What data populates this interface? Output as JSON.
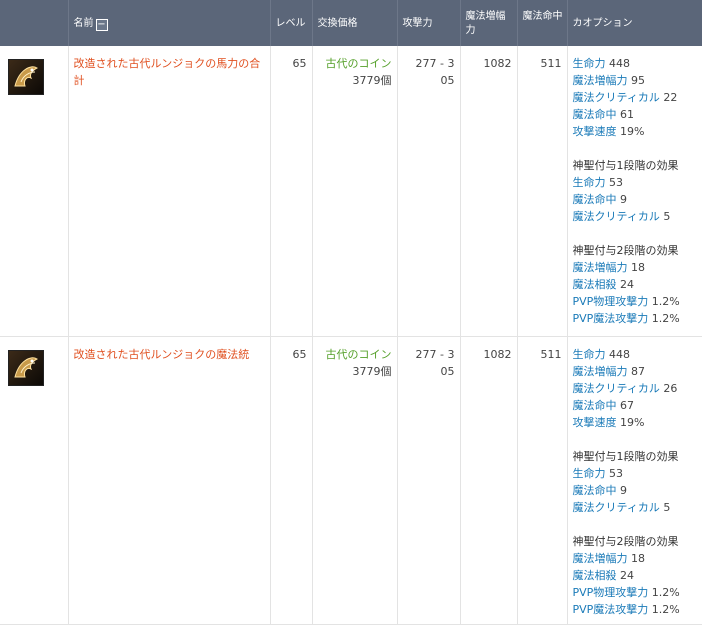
{
  "header": {
    "name": "名前",
    "toggle": "−",
    "level": "レベル",
    "price": "交換価格",
    "attack": "攻撃力",
    "magic_amp": "魔法増幅力",
    "magic_hit": "魔法命中",
    "option": "カオプション"
  },
  "rows": [
    {
      "name": "改造された古代ルンジョクの馬力の合計",
      "level": "65",
      "currency": "古代のコイン",
      "count": "3779個",
      "attack": "277 - 305",
      "magic_amp": "1082",
      "magic_hit": "511",
      "options": [
        {
          "k": "生命力",
          "v": "448"
        },
        {
          "k": "魔法増幅力",
          "v": "95"
        },
        {
          "k": "魔法クリティカル",
          "v": "22"
        },
        {
          "k": "魔法命中",
          "v": "61"
        },
        {
          "k": "攻撃速度",
          "v": "19%"
        }
      ],
      "enchant1_title": "神聖付与1段階の効果",
      "enchant1": [
        {
          "k": "生命力",
          "v": "53"
        },
        {
          "k": "魔法命中",
          "v": "9"
        },
        {
          "k": "魔法クリティカル",
          "v": "5"
        }
      ],
      "enchant2_title": "神聖付与2段階の効果",
      "enchant2": [
        {
          "k": "魔法増幅力",
          "v": "18"
        },
        {
          "k": "魔法相殺",
          "v": "24"
        },
        {
          "k": "PVP物理攻撃力",
          "v": "1.2%"
        },
        {
          "k": "PVP魔法攻撃力",
          "v": "1.2%"
        }
      ]
    },
    {
      "name": "改造された古代ルンジョクの魔法統",
      "level": "65",
      "currency": "古代のコイン",
      "count": "3779個",
      "attack": "277 - 305",
      "magic_amp": "1082",
      "magic_hit": "511",
      "options": [
        {
          "k": "生命力",
          "v": "448"
        },
        {
          "k": "魔法増幅力",
          "v": "87"
        },
        {
          "k": "魔法クリティカル",
          "v": "26"
        },
        {
          "k": "魔法命中",
          "v": "67"
        },
        {
          "k": "攻撃速度",
          "v": "19%"
        }
      ],
      "enchant1_title": "神聖付与1段階の効果",
      "enchant1": [
        {
          "k": "生命力",
          "v": "53"
        },
        {
          "k": "魔法命中",
          "v": "9"
        },
        {
          "k": "魔法クリティカル",
          "v": "5"
        }
      ],
      "enchant2_title": "神聖付与2段階の効果",
      "enchant2": [
        {
          "k": "魔法増幅力",
          "v": "18"
        },
        {
          "k": "魔法相殺",
          "v": "24"
        },
        {
          "k": "PVP物理攻撃力",
          "v": "1.2%"
        },
        {
          "k": "PVP魔法攻撃力",
          "v": "1.2%"
        }
      ]
    }
  ],
  "icons": {
    "item": "dragon-claw-icon"
  }
}
